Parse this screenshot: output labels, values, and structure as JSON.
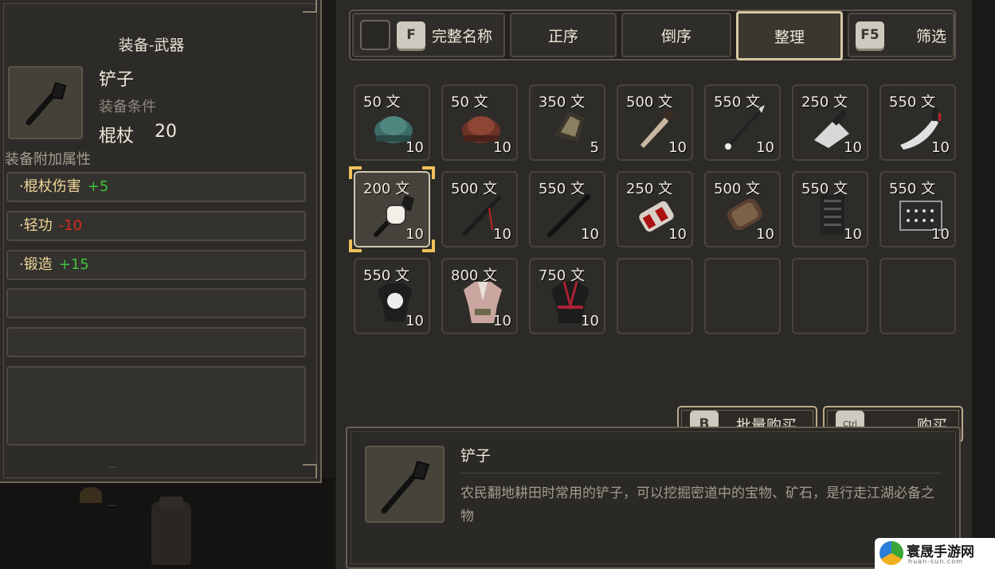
{
  "equip_panel": {
    "title": "装备-武器",
    "item_name": "铲子",
    "requirement_label": "装备条件",
    "requirement_type": "棍杖",
    "requirement_value": "20",
    "attr_title": "装备附加属性",
    "attributes": [
      {
        "name": "·棍杖伤害",
        "value": "+5"
      },
      {
        "name": "·轻功",
        "value": "-10"
      },
      {
        "name": "·锻造",
        "value": "+15"
      }
    ],
    "ellipsis": "..."
  },
  "toolbar": {
    "fullname_key": "F",
    "fullname_label": "完整名称",
    "asc_label": "正序",
    "desc_label": "倒序",
    "sort_label": "整理",
    "filter_key": "F5",
    "filter_label": "筛选"
  },
  "shop_items": [
    {
      "price": "50 文",
      "qty": "10",
      "icon": "teal-helmet"
    },
    {
      "price": "50 文",
      "qty": "10",
      "icon": "brown-helmet"
    },
    {
      "price": "350 文",
      "qty": "5",
      "icon": "dark-armor-piece"
    },
    {
      "price": "500 文",
      "qty": "10",
      "icon": "dagger"
    },
    {
      "price": "550 文",
      "qty": "10",
      "icon": "spear"
    },
    {
      "price": "250 文",
      "qty": "10",
      "icon": "cleaver"
    },
    {
      "price": "550 文",
      "qty": "10",
      "icon": "machete"
    },
    {
      "price": "200 文",
      "qty": "10",
      "icon": "shovel",
      "selected": true
    },
    {
      "price": "500 文",
      "qty": "10",
      "icon": "red-staff"
    },
    {
      "price": "550 文",
      "qty": "10",
      "icon": "black-staff"
    },
    {
      "price": "250 文",
      "qty": "10",
      "icon": "red-bracer"
    },
    {
      "price": "500 文",
      "qty": "10",
      "icon": "leather-bracer"
    },
    {
      "price": "550 文",
      "qty": "10",
      "icon": "dark-vest"
    },
    {
      "price": "550 文",
      "qty": "10",
      "icon": "studded-belt"
    },
    {
      "price": "550 文",
      "qty": "10",
      "icon": "white-robe"
    },
    {
      "price": "800 文",
      "qty": "10",
      "icon": "pink-robe"
    },
    {
      "price": "750 文",
      "qty": "10",
      "icon": "black-robe"
    }
  ],
  "buttons": {
    "bulk_key": "B",
    "bulk_label": "批量购买",
    "buy_key": "Ctrl",
    "buy_label": "购买"
  },
  "detail": {
    "name": "铲子",
    "description": "农民翻地耕田时常用的铲子，可以挖掘密道中的宝物、矿石，是行走江湖必备之物"
  },
  "watermark": {
    "text": "寰晟手游网",
    "sub": "huan-sun.com"
  },
  "colors": {
    "positive": "#3cc43a",
    "negative": "#d82a22",
    "selection": "#f0c15a"
  }
}
